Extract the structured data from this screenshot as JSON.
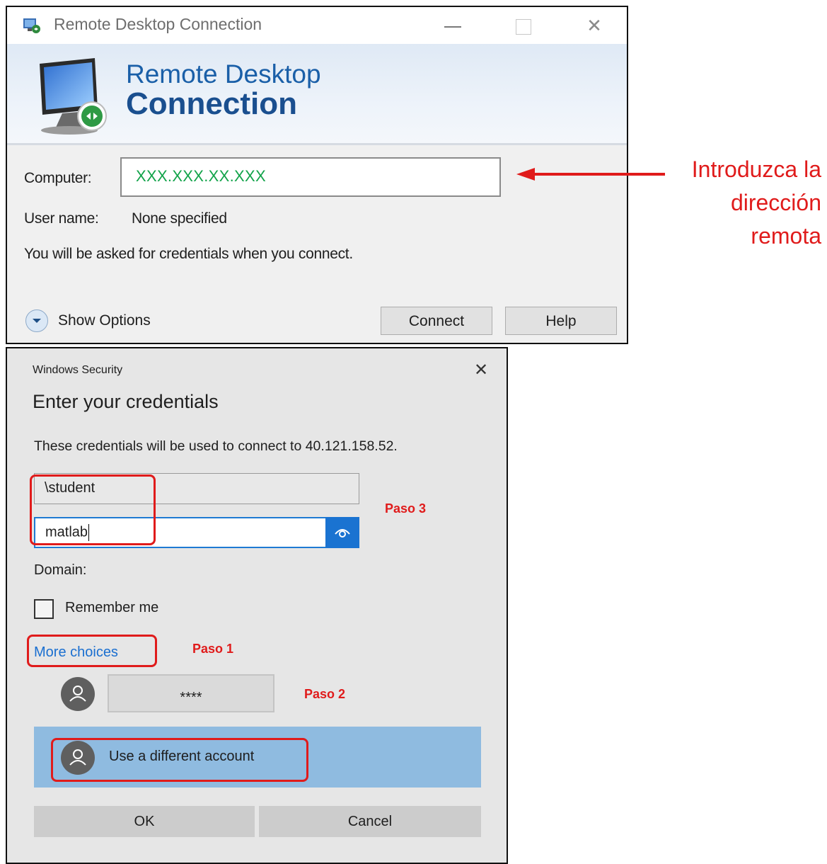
{
  "rdc": {
    "window_title": "Remote Desktop Connection",
    "banner_line1": "Remote Desktop",
    "banner_line2": "Connection",
    "computer_label": "Computer:",
    "computer_value": "XXX.XXX.XX.XXX",
    "username_label": "User name:",
    "username_value": "None specified",
    "credentials_note": "You will be asked for credentials when you connect.",
    "show_options_label": "Show Options",
    "connect_label": "Connect",
    "help_label": "Help"
  },
  "annotation": {
    "line1": "Introduzca la",
    "line2": "dirección",
    "line3": "remota",
    "color": "#e01b1b"
  },
  "security": {
    "window_title": "Windows Security",
    "close_glyph": "✕",
    "heading": "Enter your credentials",
    "description": "These credentials will be used to connect to 40.121.158.52.",
    "username_value": "\\student",
    "password_value": "matlab",
    "domain_label": "Domain:",
    "remember_label": "Remember me",
    "more_choices_label": "More choices",
    "saved_account_value": "****",
    "different_account_label": "Use a different account",
    "ok_label": "OK",
    "cancel_label": "Cancel"
  },
  "steps": {
    "step1": "Paso 1",
    "step2": "Paso 2",
    "step3": "Paso 3"
  },
  "colors": {
    "accent": "#1a73d1",
    "link": "#1a6fd0",
    "highlight": "#e01b1b",
    "computer_text": "#12a34a",
    "selected_row": "#8fbbe0"
  }
}
